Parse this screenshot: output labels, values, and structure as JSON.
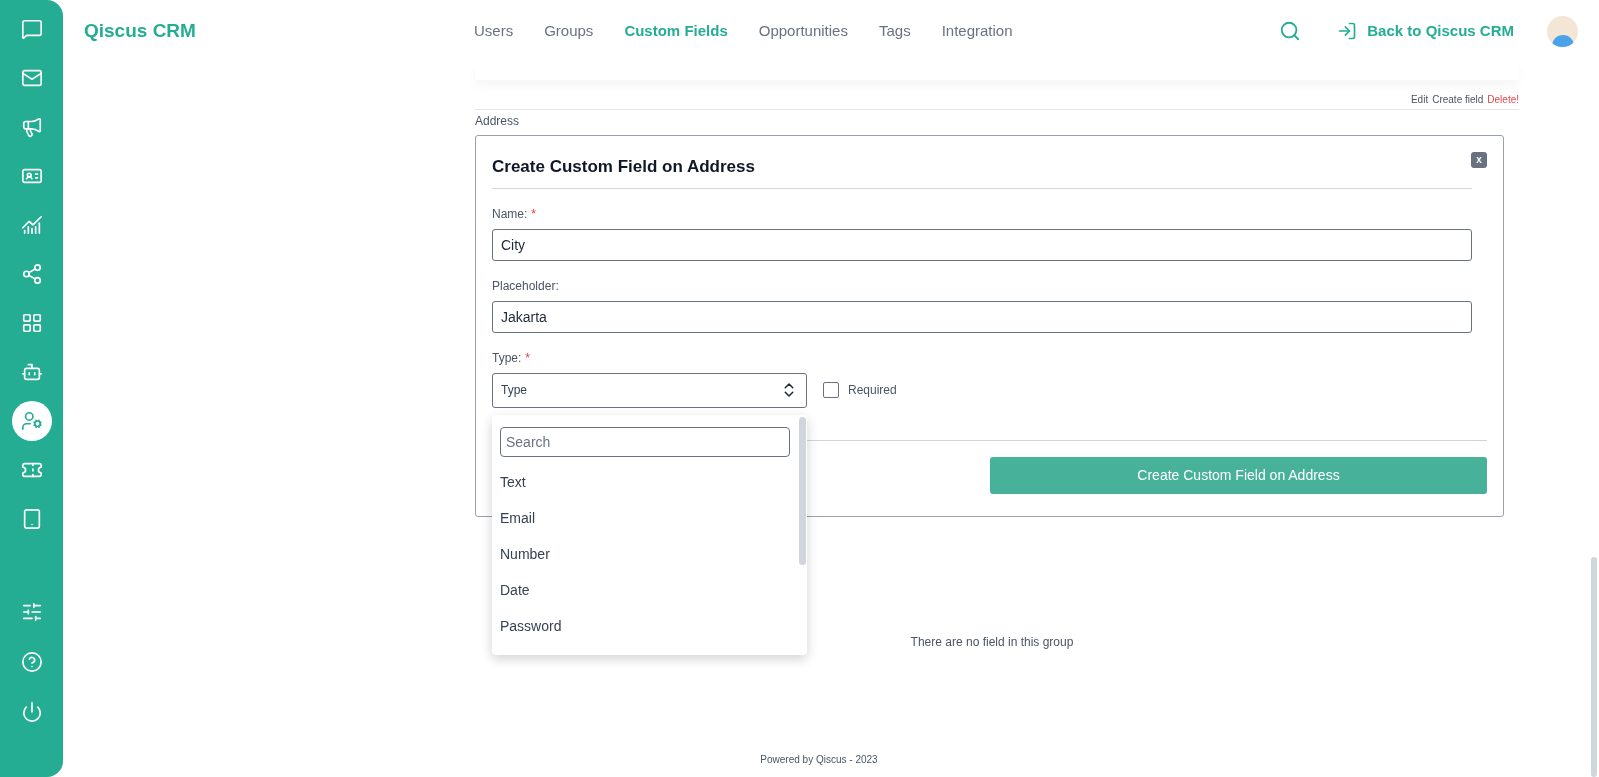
{
  "sidebar": {
    "items": [
      {
        "kind": "chat",
        "selected": false
      },
      {
        "kind": "mail",
        "selected": false
      },
      {
        "kind": "megaphone",
        "selected": false
      },
      {
        "kind": "card",
        "selected": false
      },
      {
        "kind": "chart",
        "selected": false
      },
      {
        "kind": "share",
        "selected": false
      },
      {
        "kind": "grid",
        "selected": false
      },
      {
        "kind": "bot",
        "selected": false
      },
      {
        "kind": "user",
        "selected": true
      },
      {
        "kind": "ticket",
        "selected": false
      },
      {
        "kind": "tablet",
        "selected": false
      }
    ],
    "bottom_items": [
      {
        "kind": "sliders"
      },
      {
        "kind": "help"
      },
      {
        "kind": "power"
      }
    ]
  },
  "header": {
    "title": "Qiscus CRM",
    "nav": [
      {
        "label": "Users",
        "selected": false
      },
      {
        "label": "Groups",
        "selected": false
      },
      {
        "label": "Custom Fields",
        "selected": true
      },
      {
        "label": "Opportunities",
        "selected": false
      },
      {
        "label": "Tags",
        "selected": false
      },
      {
        "label": "Integration",
        "selected": false
      }
    ],
    "back_link": "Back to Qiscus CRM"
  },
  "group": {
    "actions": [
      {
        "label": "Edit",
        "kind": "normal"
      },
      {
        "label": "Create field",
        "kind": "normal"
      },
      {
        "label": "Delete!",
        "kind": "danger"
      }
    ],
    "name": "Address",
    "empty_text": "There are no field in this group"
  },
  "form": {
    "title": "Create Custom Field on Address",
    "close": "x",
    "fields": [
      {
        "label": "Name:",
        "required_mark": "*",
        "value": "City"
      },
      {
        "label": "Placeholder:",
        "value": "Jakarta"
      }
    ],
    "type_label": "Type:",
    "type_required_mark": "*",
    "type_value": "Type",
    "required_checkbox": {
      "label": "Required",
      "checked": false
    },
    "dropdown": {
      "search_placeholder": "Search",
      "options": [
        "Text",
        "Email",
        "Number",
        "Date",
        "Password"
      ]
    },
    "submit": "Create Custom Field on Address"
  },
  "footer": "Powered by Qiscus - 2023"
}
